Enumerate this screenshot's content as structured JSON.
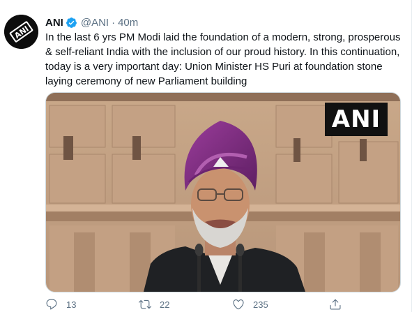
{
  "author": {
    "name": "ANI",
    "handle": "@ANI",
    "separator": "·",
    "time": "40m",
    "avatar_text": "ANI",
    "verified": true
  },
  "tweet": {
    "text": "In the last 6 yrs PM Modi laid the foundation of a modern, strong, prosperous & self-reliant India with the inclusion of our proud history. In this continuation, today is a very important day: Union Minister HS Puri at foundation stone laying ceremony of new Parliament building"
  },
  "media": {
    "watermark": "ANI",
    "turban_color": "#7b2a7e"
  },
  "actions": {
    "reply_count": "13",
    "retweet_count": "22",
    "like_count": "235",
    "icons": [
      "reply-icon",
      "retweet-icon",
      "like-icon",
      "share-icon"
    ]
  },
  "colors": {
    "verified_blue": "#1da1f2",
    "secondary_text": "#5b7083"
  }
}
